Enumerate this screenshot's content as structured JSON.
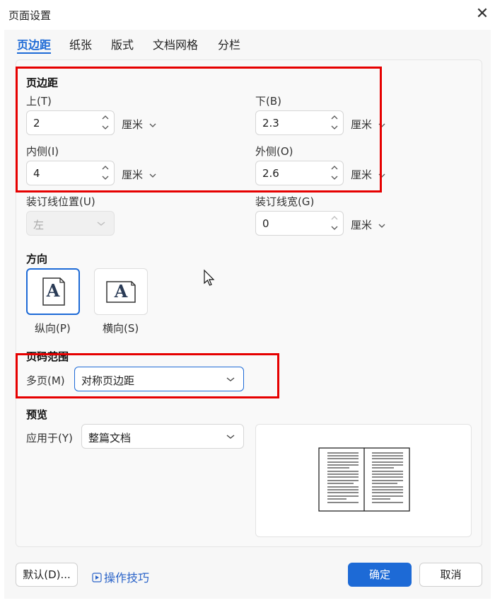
{
  "window": {
    "title": "页面设置",
    "close_glyph": "✕"
  },
  "tabs": [
    {
      "label": "页边距"
    },
    {
      "label": "纸张"
    },
    {
      "label": "版式"
    },
    {
      "label": "文档网格"
    },
    {
      "label": "分栏"
    }
  ],
  "margins": {
    "section_title": "页边距",
    "top": {
      "label": "上(T)",
      "value": "2",
      "unit": "厘米"
    },
    "bottom": {
      "label": "下(B)",
      "value": "2.3",
      "unit": "厘米"
    },
    "inside": {
      "label": "内侧(I)",
      "value": "4",
      "unit": "厘米"
    },
    "outside": {
      "label": "外侧(O)",
      "value": "2.6",
      "unit": "厘米"
    },
    "gutter_pos": {
      "label": "装订线位置(U)",
      "value": "左"
    },
    "gutter_width": {
      "label": "装订线宽(G)",
      "value": "0",
      "unit": "厘米"
    }
  },
  "orientation": {
    "section_title": "方向",
    "glyph": "A",
    "portrait_label": "纵向(P)",
    "landscape_label": "横向(S)"
  },
  "page_range": {
    "section_title": "页码范围",
    "multiple_label": "多页(M)",
    "multiple_value": "对称页边距"
  },
  "preview": {
    "section_title": "预览",
    "apply_label": "应用于(Y)",
    "apply_value": "整篇文档"
  },
  "footer": {
    "default_label": "默认(D)...",
    "tips_label": "操作技巧",
    "ok_label": "确定",
    "cancel_label": "取消"
  },
  "colors": {
    "accent": "#1d6ad6",
    "highlight": "#e60000"
  }
}
